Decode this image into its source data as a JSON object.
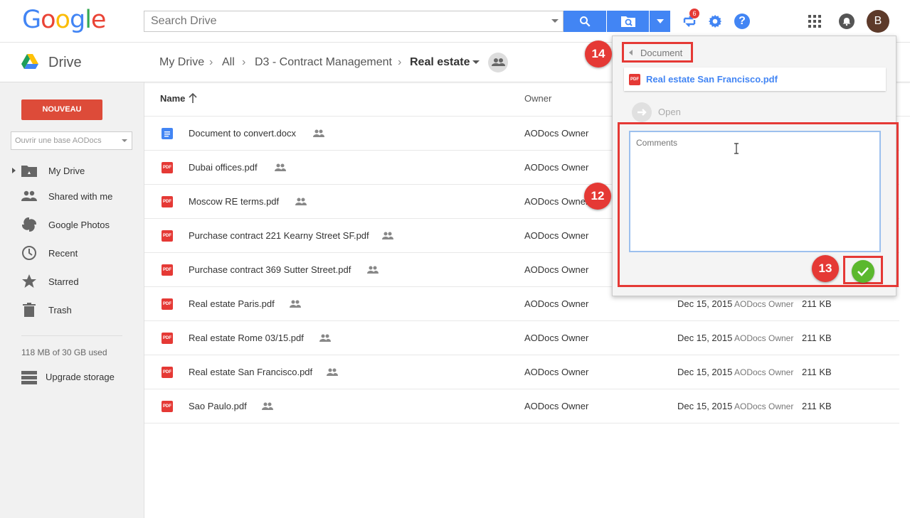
{
  "header": {
    "logo": "Google",
    "search_placeholder": "Search Drive",
    "notification_count": "6",
    "avatar_letter": "B"
  },
  "subheader": {
    "app_name": "Drive",
    "breadcrumbs": [
      "My Drive",
      "All",
      "D3 - Contract Management",
      "Real estate"
    ]
  },
  "sidebar": {
    "new_button": "NOUVEAU",
    "base_select": "Ouvrir une base AODocs",
    "items": [
      {
        "label": "My Drive",
        "icon": "my-drive-icon"
      },
      {
        "label": "Shared with me",
        "icon": "shared-icon"
      },
      {
        "label": "Google Photos",
        "icon": "photos-icon"
      },
      {
        "label": "Recent",
        "icon": "clock-icon"
      },
      {
        "label": "Starred",
        "icon": "star-icon"
      },
      {
        "label": "Trash",
        "icon": "trash-icon"
      }
    ],
    "storage": "118 MB of 30 GB used",
    "upgrade": "Upgrade storage"
  },
  "table": {
    "col_name": "Name",
    "col_owner": "Owner",
    "rows": [
      {
        "name": "Document to convert.docx",
        "type": "doc",
        "owner": "AODocs Owner",
        "date": "",
        "modby": "",
        "size": ""
      },
      {
        "name": "Dubai offices.pdf",
        "type": "pdf",
        "owner": "AODocs Owner",
        "date": "",
        "modby": "",
        "size": ""
      },
      {
        "name": "Moscow RE terms.pdf",
        "type": "pdf",
        "owner": "AODocs Owner",
        "date": "",
        "modby": "",
        "size": ""
      },
      {
        "name": "Purchase contract 221 Kearny Street SF.pdf",
        "type": "pdf",
        "owner": "AODocs Owner",
        "date": "",
        "modby": "",
        "size": ""
      },
      {
        "name": "Purchase contract 369 Sutter Street.pdf",
        "type": "pdf",
        "owner": "AODocs Owner",
        "date": "",
        "modby": "",
        "size": ""
      },
      {
        "name": "Real estate Paris.pdf",
        "type": "pdf",
        "owner": "AODocs Owner",
        "date": "Dec 15, 2015",
        "modby": "AODocs Owner",
        "size": "211 KB"
      },
      {
        "name": "Real estate Rome 03/15.pdf",
        "type": "pdf",
        "owner": "AODocs Owner",
        "date": "Dec 15, 2015",
        "modby": "AODocs Owner",
        "size": "211 KB"
      },
      {
        "name": "Real estate San Francisco.pdf",
        "type": "pdf",
        "owner": "AODocs Owner",
        "date": "Dec 15, 2015",
        "modby": "AODocs Owner",
        "size": "211 KB"
      },
      {
        "name": "Sao Paulo.pdf",
        "type": "pdf",
        "owner": "AODocs Owner",
        "date": "Dec 15, 2015",
        "modby": "AODocs Owner",
        "size": "211 KB"
      }
    ]
  },
  "panel": {
    "back_label": "Document",
    "file_name": "Real estate San Francisco.pdf",
    "pdf_tag": "PDF",
    "open_label": "Open",
    "comments_placeholder": "Comments"
  },
  "annotations": [
    "14",
    "12",
    "13"
  ],
  "colors": {
    "accent": "#4285f4",
    "new_button": "#dd4b39",
    "annotation": "#e53935",
    "confirm": "#5bb82e"
  }
}
